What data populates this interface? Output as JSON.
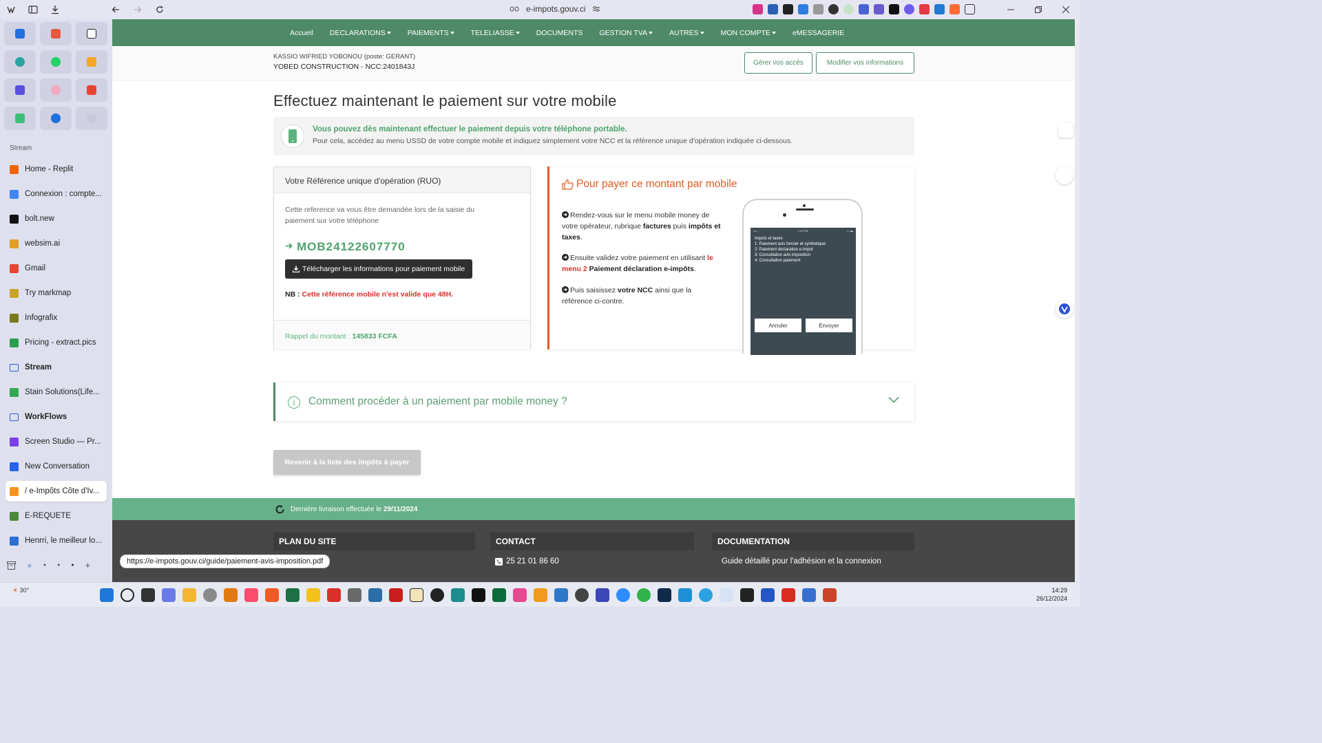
{
  "browser": {
    "url": "e-impots.gouv.ci",
    "status_url": "https://e-impots.gouv.ci/guide/paiement-avis-imposition.pdf"
  },
  "sidebar": {
    "section_label": "Stream",
    "items": [
      {
        "label": "Home - Replit",
        "color": "#f26207",
        "kind": "icon"
      },
      {
        "label": "Connexion : compte...",
        "color": "#4285f4",
        "kind": "icon"
      },
      {
        "label": "bolt.new",
        "color": "#111111",
        "kind": "icon"
      },
      {
        "label": "websim.ai",
        "color": "#e0a020",
        "kind": "icon"
      },
      {
        "label": "Gmail",
        "color": "#ea4335",
        "kind": "icon"
      },
      {
        "label": "Try markmap",
        "color": "#c9a227",
        "kind": "icon"
      },
      {
        "label": "Infografix",
        "color": "#7a7a20",
        "kind": "icon"
      },
      {
        "label": "Pricing - extract.pics",
        "color": "#2e9d52",
        "kind": "icon"
      },
      {
        "label": "Stream",
        "color": "#2a5bd7",
        "kind": "folder"
      },
      {
        "label": "Stain Solutions(Life...",
        "color": "#34a853",
        "kind": "icon"
      },
      {
        "label": "WorkFlows",
        "color": "#2a5bd7",
        "kind": "folder"
      },
      {
        "label": "Screen Studio — Pr...",
        "color": "#7b3fe4",
        "kind": "icon"
      },
      {
        "label": "New Conversation",
        "color": "#2563eb",
        "kind": "icon"
      },
      {
        "label": "/ e-Impôts Côte d'Iv...",
        "color": "#f7941d",
        "kind": "icon",
        "active": true
      },
      {
        "label": "E-REQUETE",
        "color": "#4a8a3c",
        "kind": "icon"
      },
      {
        "label": "Henrri, le meilleur lo...",
        "color": "#2a6fd1",
        "kind": "icon"
      }
    ]
  },
  "nav": {
    "items": [
      {
        "label": "Accueil",
        "dropdown": false
      },
      {
        "label": "DECLARATIONS",
        "dropdown": true
      },
      {
        "label": "PAIEMENTS",
        "dropdown": true
      },
      {
        "label": "TELELIASSE",
        "dropdown": true
      },
      {
        "label": "DOCUMENTS",
        "dropdown": false
      },
      {
        "label": "GESTION TVA",
        "dropdown": true
      },
      {
        "label": "AUTRES",
        "dropdown": true
      },
      {
        "label": "MON COMPTE",
        "dropdown": true
      },
      {
        "label": "eMESSAGERIE",
        "dropdown": false
      }
    ]
  },
  "user": {
    "line1": "KASSIO WIFRIED YOBONOU (poste: GERANT)",
    "line2": "YOBED CONSTRUCTION - NCC:2401843J",
    "btn_access": "Gérer vos accès",
    "btn_modify": "Modifier vos informations"
  },
  "main": {
    "title": "Effectuez maintenant le paiement sur votre mobile",
    "info_title": "Vous pouvez dès maintenant effectuer le paiement depuis votre téléphone portable.",
    "info_text": "Pour cela, accédez au menu USSD de votre compte mobile et indiquez simplement votre NCC et la référence unique d'opération indiquée ci-dessous."
  },
  "ruo": {
    "header": "Votre Référence unique d'opération (RUO)",
    "desc": "Cette reference va vous être demandée lors de la saisie du paiement sur votre téléphone",
    "code": "MOB24122607770",
    "download_label": "Télécharger les informations pour paiement mobile",
    "nb_prefix": "NB : ",
    "nb_text": "Cette référence mobile n'est valide que 48H.",
    "amount_label": "Rappel du montant : ",
    "amount_value": "145833 FCFA"
  },
  "pay": {
    "title": "Pour payer ce montant par mobile",
    "step1_a": "Rendez-vous sur le menu mobile money de votre opérateur, rubrique ",
    "step1_b": "factures",
    "step1_c": " puis ",
    "step1_d": "impôts et taxes",
    "step1_e": ".",
    "step2_a": "Ensuite validez votre paiement en utilisant ",
    "step2_b": "le menu 2",
    "step2_c": " Paiement déclaration e-impôts",
    "step2_d": ".",
    "step3_a": "Puis saisissez ",
    "step3_b": "votre NCC",
    "step3_c": " ainsi que la référence ci-contre.",
    "phone": {
      "status_left": "•••• ◦",
      "status_time": "1:10 PM",
      "status_right": "▪ ▪ ▬",
      "menu_title": "Impots et taxes",
      "menu_1": "1: Paiement avis foncier et synthetique",
      "menu_2": "2: Paiement declaration e-impot",
      "menu_3": "3: Consultation avis imposition",
      "menu_4": "4: Consultation paiement",
      "btn_cancel": "Annuler",
      "btn_send": "Envoyer"
    }
  },
  "faq": {
    "icon_glyph": "i",
    "title": "Comment procéder à un paiement par mobile money ?"
  },
  "back_button": "Revenir à la liste des impôts à payer",
  "livraison": {
    "prefix": "Dernière livraison effectuée le ",
    "date": "29/11/2024"
  },
  "footer": {
    "plan": "PLAN DU SITE",
    "contact": "CONTACT",
    "documentation": "DOCUMENTATION",
    "phone": "25 21 01 86 60",
    "doc_link": "Guide détaillé pour l'adhésion et la connexion"
  },
  "taskbar": {
    "weather": "30°",
    "time": "14:29",
    "date": "26/12/2024"
  },
  "colors": {
    "brand_green": "#4e8a67",
    "accent_orange": "#e05b20",
    "link_green": "#4ea36d",
    "alert_red": "#d9302b"
  }
}
